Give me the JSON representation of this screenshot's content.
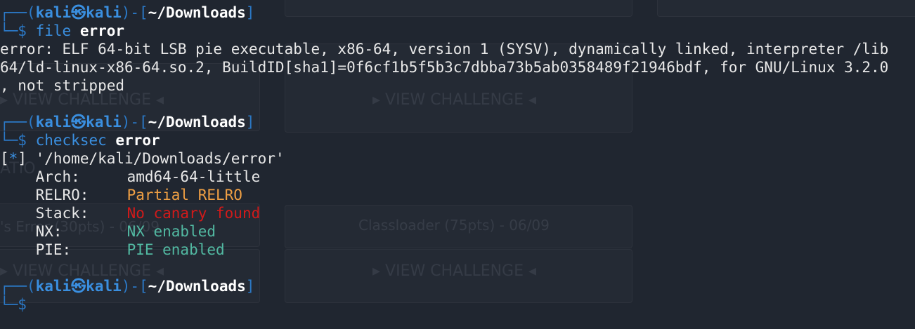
{
  "terminal": {
    "prompt": {
      "user": "kali",
      "separator_glyph": "㉿",
      "host": "kali",
      "cwd": "~/Downloads",
      "symbol": "$"
    },
    "blocks": [
      {
        "command": "file",
        "argument": "error",
        "output": [
          "error: ELF 64-bit LSB pie executable, x86-64, version 1 (SYSV), dynamically linked, interpreter /lib",
          "64/ld-linux-x86-64.so.2, BuildID[sha1]=0f6cf1b5f5b3c7dbba73b5ab0358489f21946bdf, for GNU/Linux 3.2.0",
          ", not stripped"
        ]
      },
      {
        "command": "checksec",
        "argument": "error",
        "info_marker": "*",
        "info_path": "'/home/kali/Downloads/error'",
        "properties": [
          {
            "label": "Arch:",
            "value": "amd64-64-little",
            "color": "#e8e8e8"
          },
          {
            "label": "RELRO:",
            "value": "Partial RELRO",
            "color": "#f0a044"
          },
          {
            "label": "Stack:",
            "value": "No canary found",
            "color": "#d11a1a"
          },
          {
            "label": "NX:",
            "value": "NX enabled",
            "color": "#52b9a2"
          },
          {
            "label": "PIE:",
            "value": "PIE enabled",
            "color": "#52b9a2"
          }
        ]
      }
    ]
  },
  "background_page": {
    "view_challenge": "VIEW CHALLENGE",
    "classloader_title": "Classloader (75pts) - 06/09",
    "left_fragment_1": "ATIO",
    "left_fragment_2": "'s Error (30pts) - 06/09"
  },
  "colors": {
    "background": "#202630",
    "prompt_frame": "#2b79c7",
    "prompt_user": "#3a8fe0",
    "text": "#e8e8e8"
  }
}
